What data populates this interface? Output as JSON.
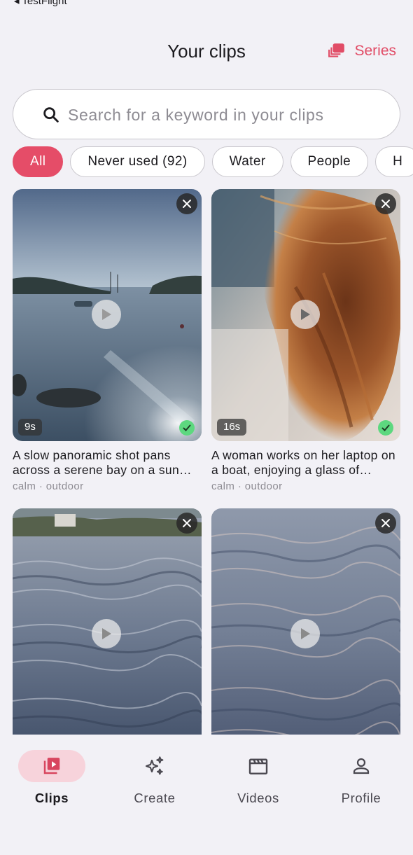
{
  "status": {
    "back_label": "◂ TestFlight"
  },
  "header": {
    "title": "Your clips",
    "series_label": "Series"
  },
  "search": {
    "placeholder": "Search for a keyword in your clips",
    "value": ""
  },
  "filters": [
    "All",
    "Never used (92)",
    "Water",
    "People",
    "H"
  ],
  "active_filter": "All",
  "clips": [
    {
      "duration": "9s",
      "description": "A slow panoramic shot pans across a serene bay on a sun…",
      "tags": "calm · outdoor",
      "used": true
    },
    {
      "duration": "16s",
      "description": "A woman works on her laptop on a boat, enjoying a glass of…",
      "tags": "calm · outdoor",
      "used": true
    },
    {
      "duration": "",
      "description": "",
      "tags": "",
      "used": false
    },
    {
      "duration": "",
      "description": "",
      "tags": "",
      "used": false
    }
  ],
  "nav": {
    "items": [
      {
        "label": "Clips",
        "icon": "clips-icon",
        "active": true
      },
      {
        "label": "Create",
        "icon": "sparkle-icon",
        "active": false
      },
      {
        "label": "Videos",
        "icon": "film-icon",
        "active": false
      },
      {
        "label": "Profile",
        "icon": "person-icon",
        "active": false
      }
    ]
  },
  "colors": {
    "accent": "#e54d68",
    "check": "#5dd87f",
    "background": "#f2f1f6"
  }
}
